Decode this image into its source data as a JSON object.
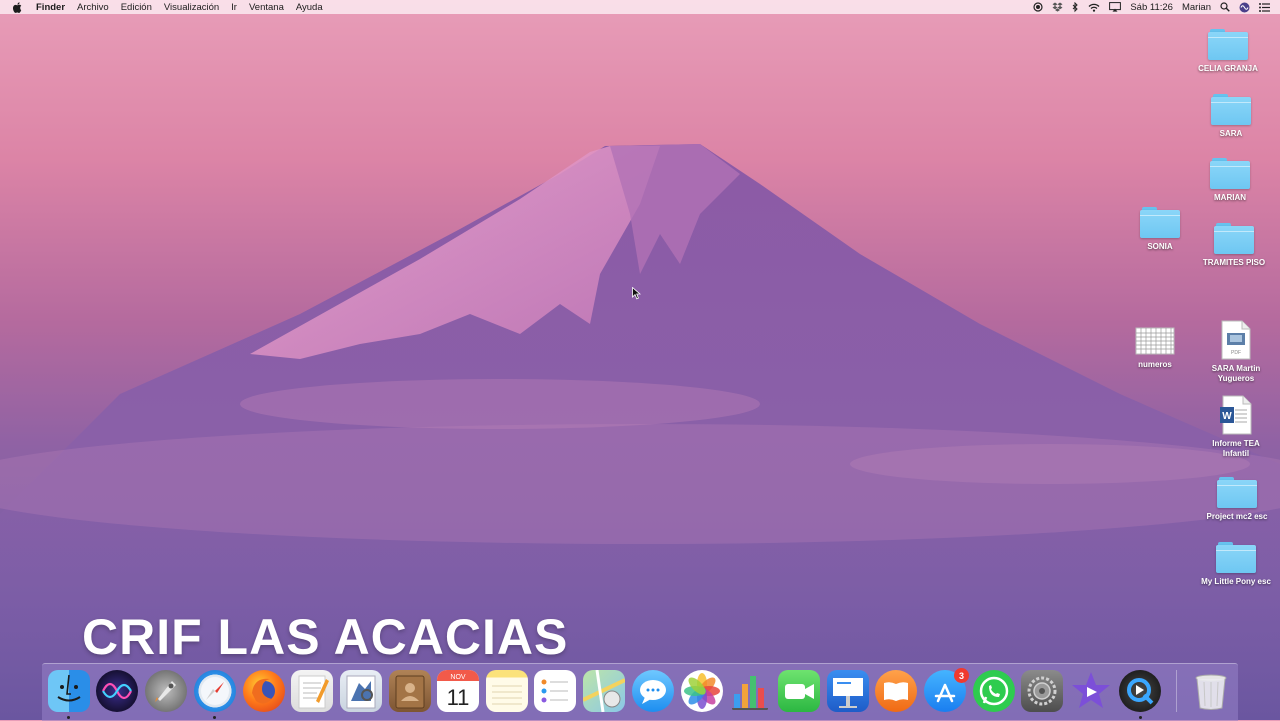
{
  "menubar": {
    "app_name": "Finder",
    "menus": [
      "Archivo",
      "Edición",
      "Visualización",
      "Ir",
      "Ventana",
      "Ayuda"
    ],
    "clock": "Sáb 11:26",
    "user": "Marian"
  },
  "desktop_icons": [
    {
      "name": "folder-celia-granja",
      "label": "CELIA GRANJA",
      "type": "folder"
    },
    {
      "name": "folder-sara",
      "label": "SARA",
      "type": "folder"
    },
    {
      "name": "folder-marian",
      "label": "MARIAN",
      "type": "folder"
    },
    {
      "name": "folder-sonia",
      "label": "SONIA",
      "type": "folder"
    },
    {
      "name": "folder-tramites-piso",
      "label": "TRAMITES PISO",
      "type": "folder"
    },
    {
      "name": "file-numeros",
      "label": "numeros",
      "type": "spreadsheet"
    },
    {
      "name": "file-sara-martin-yugueros",
      "label": "SARA Martin\nYugueros",
      "type": "pdf"
    },
    {
      "name": "file-informe-tea-infantil",
      "label": "Informe TEA\nInfantil",
      "type": "word"
    },
    {
      "name": "folder-project-mc2-esc",
      "label": "Project mc2 esc",
      "type": "folder"
    },
    {
      "name": "folder-my-little-pony-esc",
      "label": "My Little Pony esc",
      "type": "folder"
    }
  ],
  "banner": {
    "text": "CRIF LAS ACACIAS"
  },
  "dock": {
    "apps": [
      "finder-icon",
      "siri-icon",
      "launchpad-icon",
      "safari-icon",
      "firefox-icon",
      "pages-icon",
      "preview-icon",
      "contacts-icon",
      "calendar-icon",
      "notes-icon",
      "reminders-icon",
      "maps-icon",
      "messages-icon",
      "photos-icon",
      "numbers-icon",
      "facetime-icon",
      "keynote-icon",
      "books-icon",
      "app-store-icon",
      "whatsapp-icon",
      "system-preferences-icon",
      "imovie-icon",
      "quicktime-icon",
      "trash-icon"
    ],
    "calendar_month": "NOV",
    "calendar_day": "11",
    "app_store_badge": "3",
    "pdf_tag": "PDF",
    "word_tag": "W"
  },
  "colors": {
    "folder": "#74caf3",
    "menubar_bg": "#fae4ec",
    "badge": "#f03a2e"
  }
}
